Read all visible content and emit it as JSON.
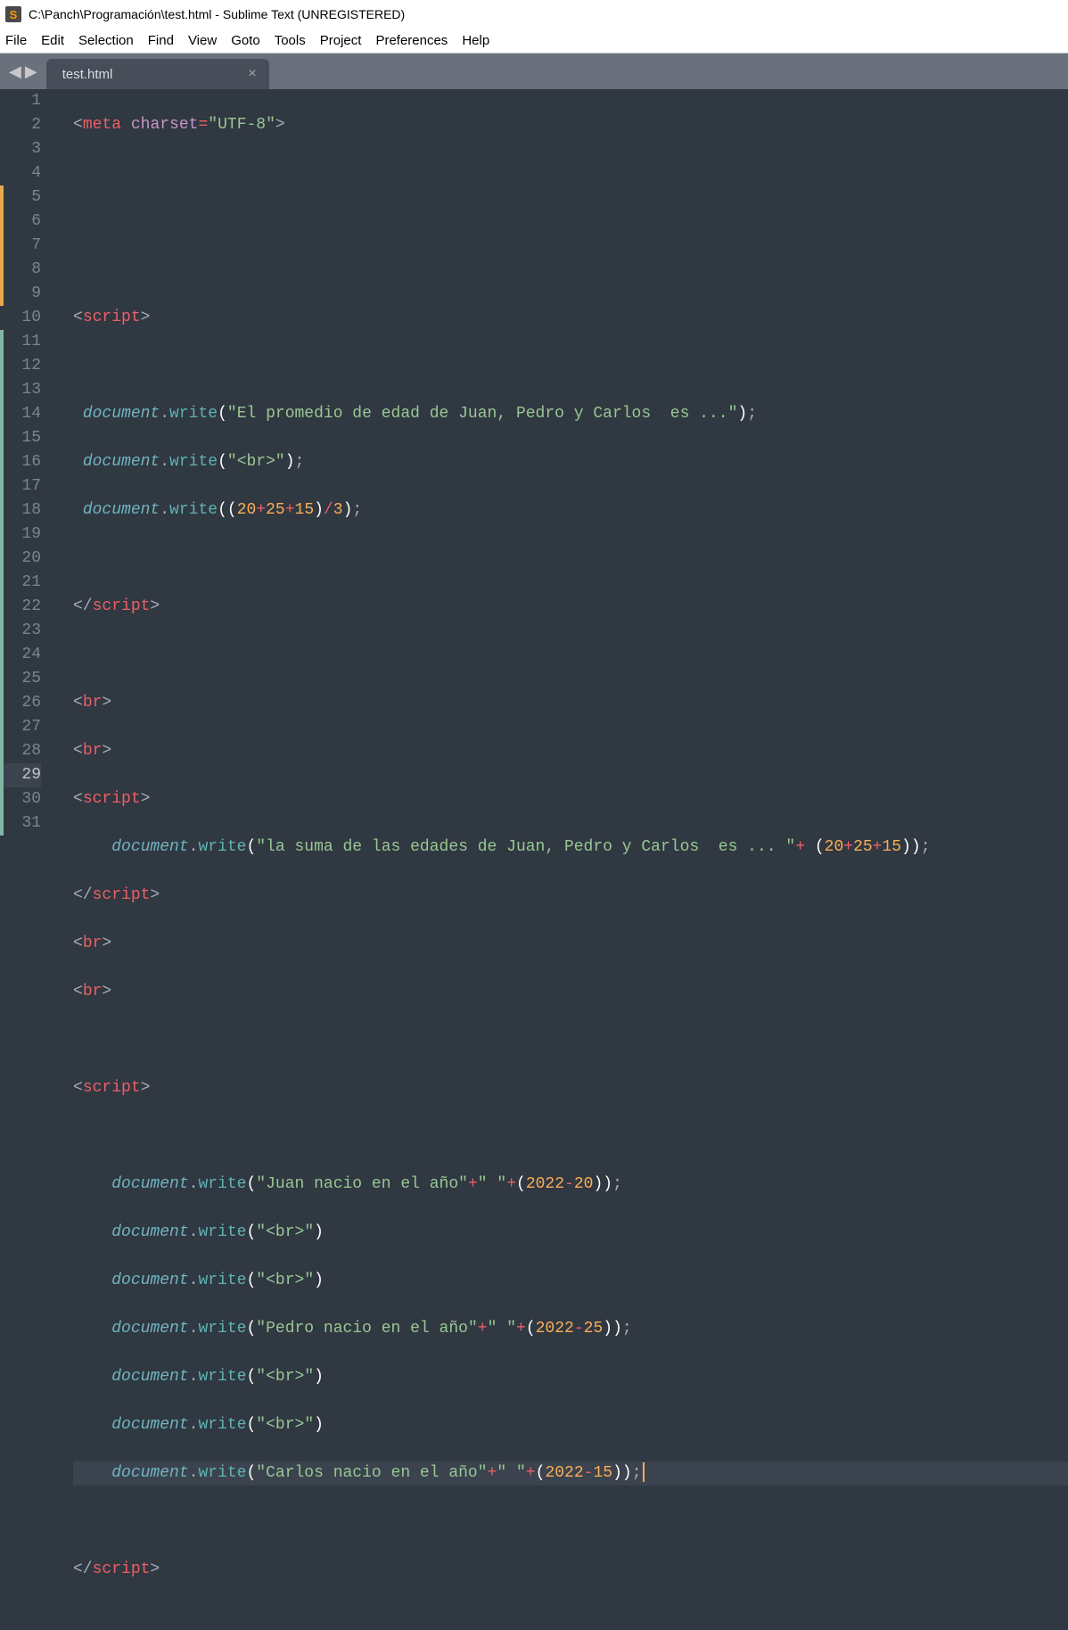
{
  "title": "C:\\Panch\\Programación\\test.html - Sublime Text (UNREGISTERED)",
  "app_icon_letter": "S",
  "menu": [
    "File",
    "Edit",
    "Selection",
    "Find",
    "View",
    "Goto",
    "Tools",
    "Project",
    "Preferences",
    "Help"
  ],
  "nav": {
    "back": "◀",
    "forward": "▶"
  },
  "tab": {
    "label": "test.html",
    "close": "×"
  },
  "gutter": {
    "lines": [
      "1",
      "2",
      "3",
      "4",
      "5",
      "6",
      "7",
      "8",
      "9",
      "10",
      "11",
      "12",
      "13",
      "14",
      "15",
      "16",
      "17",
      "18",
      "19",
      "20",
      "21",
      "22",
      "23",
      "24",
      "25",
      "26",
      "27",
      "28",
      "29",
      "30",
      "31"
    ],
    "highlight_index": 28,
    "mods": [
      {
        "start": 5,
        "end": 9,
        "cls": "seg-orange"
      },
      {
        "start": 11,
        "end": 31,
        "cls": "seg-teal"
      }
    ]
  },
  "code": {
    "l1": {
      "lt": "<",
      "tag": "meta",
      "attr": "charset",
      "eq": "=",
      "q1": "\"",
      "val": "UTF-8",
      "q2": "\"",
      "gt": ">"
    },
    "l5": {
      "lt": "<",
      "tag": "script",
      "gt": ">"
    },
    "l7": {
      "obj": "document",
      "dot": ".",
      "m": "write",
      "op": "(",
      "q1": "\"",
      "s": "El promedio de edad de Juan, Pedro y Carlos  es ...",
      "q2": "\"",
      "cp": ")",
      "sc": ";"
    },
    "l8": {
      "obj": "document",
      "dot": ".",
      "m": "write",
      "op": "(",
      "q1": "\"",
      "s": "<br>",
      "q2": "\"",
      "cp": ")",
      "sc": ";"
    },
    "l9": {
      "obj": "document",
      "dot": ".",
      "m": "write",
      "op": "(",
      "op2": "(",
      "n1": "20",
      "p1": "+",
      "n2": "25",
      "p2": "+",
      "n3": "15",
      "cp2": ")",
      "div": "/",
      "n4": "3",
      "cp": ")",
      "sc": ";"
    },
    "l11": {
      "lt": "</",
      "tag": "script",
      "gt": ">"
    },
    "l13": {
      "lt": "<",
      "tag": "br",
      "gt": ">"
    },
    "l14": {
      "lt": "<",
      "tag": "br",
      "gt": ">"
    },
    "l15": {
      "lt": "<",
      "tag": "script",
      "gt": ">"
    },
    "l16": {
      "obj": "document",
      "dot": ".",
      "m": "write",
      "op": "(",
      "q1": "\"",
      "s": "la suma de las edades de Juan, Pedro y Carlos  es ... ",
      "q2": "\"",
      "plus": "+",
      "sp": " ",
      "op2": "(",
      "n1": "20",
      "p1": "+",
      "n2": "25",
      "p2": "+",
      "n3": "15",
      "cp2": ")",
      "cp": ")",
      "sc": ";"
    },
    "l17": {
      "lt": "</",
      "tag": "script",
      "gt": ">"
    },
    "l18": {
      "lt": "<",
      "tag": "br",
      "gt": ">"
    },
    "l19": {
      "lt": "<",
      "tag": "br",
      "gt": ">"
    },
    "l21": {
      "lt": "<",
      "tag": "script",
      "gt": ">"
    },
    "l23": {
      "obj": "document",
      "dot": ".",
      "m": "write",
      "op": "(",
      "q1": "\"",
      "s": "Juan nacio en el año",
      "q2": "\"",
      "plus": "+",
      "q3": "\"",
      "s2": " ",
      "q4": "\"",
      "plus2": "+",
      "op2": "(",
      "n1": "2022",
      "minus": "-",
      "n2": "20",
      "cp2": ")",
      "cp": ")",
      "sc": ";"
    },
    "l24": {
      "obj": "document",
      "dot": ".",
      "m": "write",
      "op": "(",
      "q1": "\"",
      "s": "<br>",
      "q2": "\"",
      "cp": ")"
    },
    "l25": {
      "obj": "document",
      "dot": ".",
      "m": "write",
      "op": "(",
      "q1": "\"",
      "s": "<br>",
      "q2": "\"",
      "cp": ")"
    },
    "l26": {
      "obj": "document",
      "dot": ".",
      "m": "write",
      "op": "(",
      "q1": "\"",
      "s": "Pedro nacio en el año",
      "q2": "\"",
      "plus": "+",
      "q3": "\"",
      "s2": " ",
      "q4": "\"",
      "plus2": "+",
      "op2": "(",
      "n1": "2022",
      "minus": "-",
      "n2": "25",
      "cp2": ")",
      "cp": ")",
      "sc": ";"
    },
    "l27": {
      "obj": "document",
      "dot": ".",
      "m": "write",
      "op": "(",
      "q1": "\"",
      "s": "<br>",
      "q2": "\"",
      "cp": ")"
    },
    "l28": {
      "obj": "document",
      "dot": ".",
      "m": "write",
      "op": "(",
      "q1": "\"",
      "s": "<br>",
      "q2": "\"",
      "cp": ")"
    },
    "l29": {
      "obj": "document",
      "dot": ".",
      "m": "write",
      "op": "(",
      "q1": "\"",
      "s": "Carlos nacio en el año",
      "q2": "\"",
      "plus": "+",
      "q3": "\"",
      "s2": " ",
      "q4": "\"",
      "plus2": "+",
      "op2": "(",
      "n1": "2022",
      "minus": "-",
      "n2": "15",
      "cp2": ")",
      "cp": ")",
      "sc": ";"
    },
    "l31": {
      "lt": "</",
      "tag": "script",
      "gt": ">"
    }
  }
}
